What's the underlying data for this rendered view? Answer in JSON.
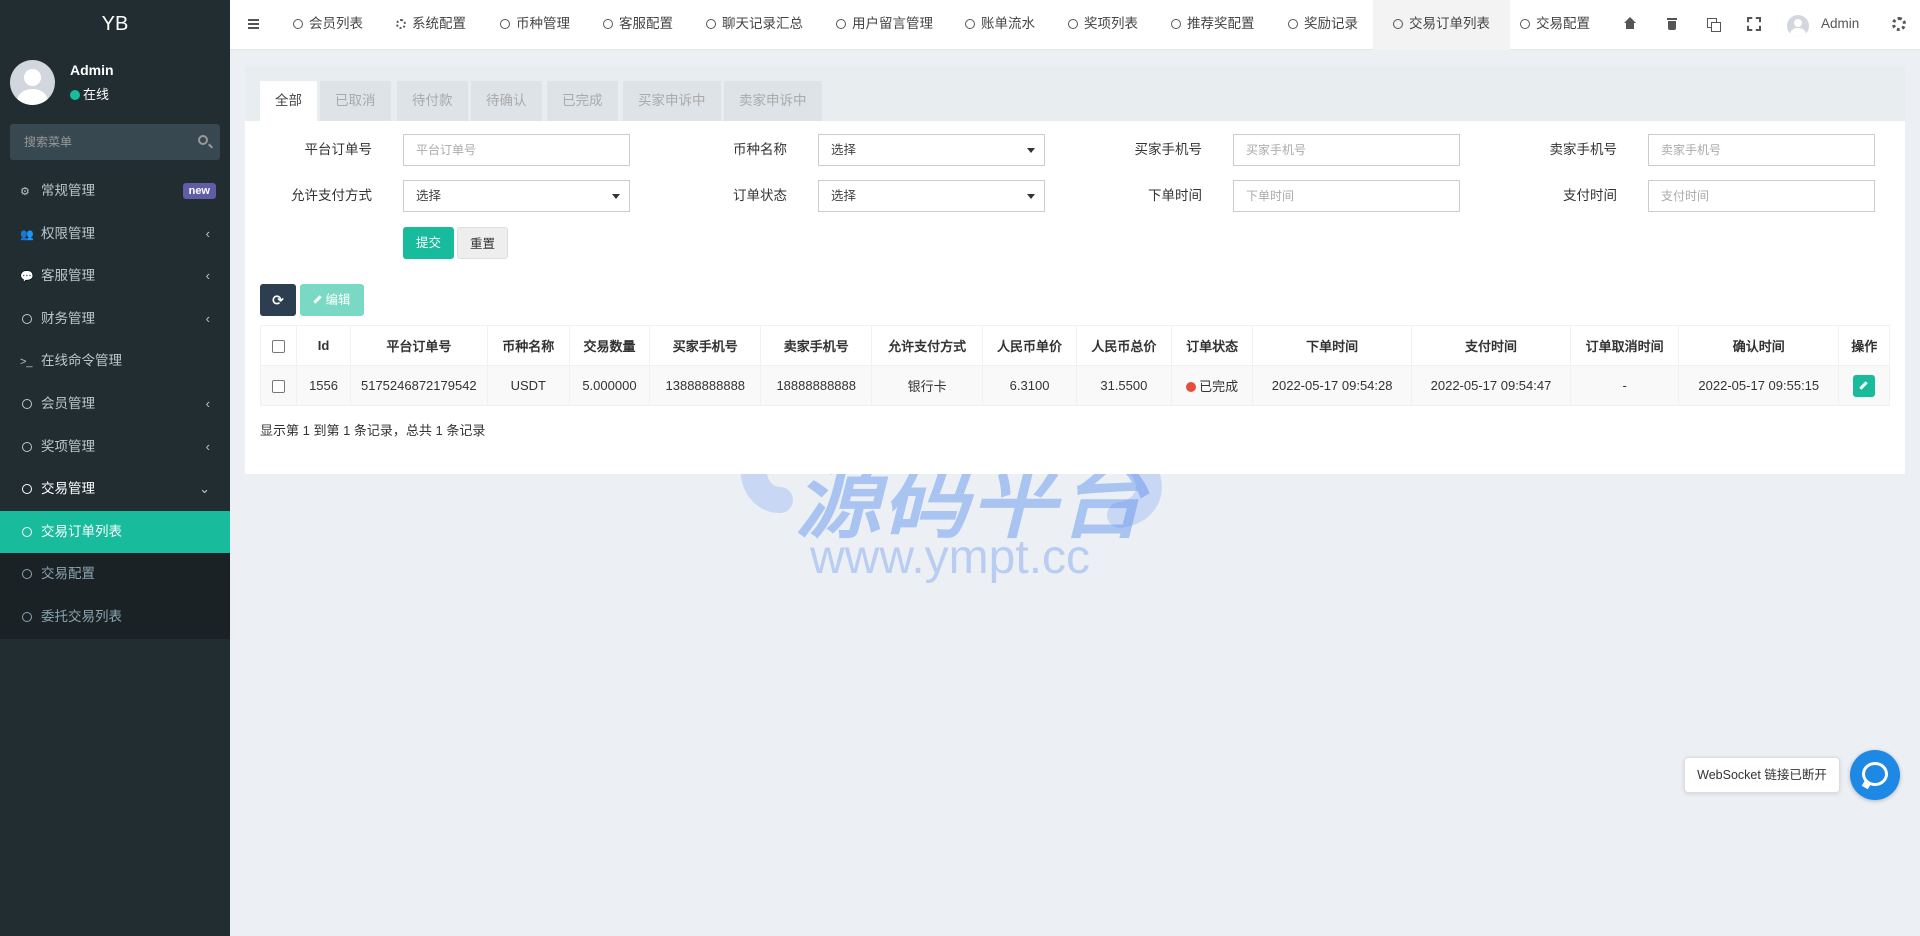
{
  "sidebar": {
    "logo": "YB",
    "user": {
      "name": "Admin",
      "status": "在线"
    },
    "search_placeholder": "搜索菜单",
    "menu": [
      {
        "label": "常规管理",
        "badge": "new"
      },
      {
        "label": "权限管理"
      },
      {
        "label": "客服管理"
      },
      {
        "label": "财务管理"
      },
      {
        "label": "在线命令管理"
      },
      {
        "label": "会员管理"
      },
      {
        "label": "奖项管理"
      },
      {
        "label": "交易管理"
      }
    ],
    "submenu": [
      {
        "label": "交易订单列表"
      },
      {
        "label": "交易配置"
      },
      {
        "label": "委托交易列表"
      }
    ]
  },
  "topnav": {
    "items": [
      {
        "label": "会员列表"
      },
      {
        "label": "系统配置"
      },
      {
        "label": "币种管理"
      },
      {
        "label": "客服配置"
      },
      {
        "label": "聊天记录汇总"
      },
      {
        "label": "用户留言管理"
      },
      {
        "label": "账单流水"
      },
      {
        "label": "奖项列表"
      },
      {
        "label": "推荐奖配置"
      },
      {
        "label": "奖励记录"
      },
      {
        "label": "交易订单列表"
      },
      {
        "label": "交易配置"
      }
    ],
    "admin_name": "Admin"
  },
  "status_tabs": [
    "全部",
    "已取消",
    "待付款",
    "待确认",
    "已完成",
    "买家申诉中",
    "卖家申诉中"
  ],
  "filters": {
    "platform_order_no": {
      "label": "平台订单号",
      "placeholder": "平台订单号"
    },
    "coin_name": {
      "label": "币种名称",
      "value": "选择"
    },
    "buyer_phone": {
      "label": "买家手机号",
      "placeholder": "买家手机号"
    },
    "seller_phone": {
      "label": "卖家手机号",
      "placeholder": "卖家手机号"
    },
    "payment_method": {
      "label": "允许支付方式",
      "value": "选择"
    },
    "order_status": {
      "label": "订单状态",
      "value": "选择"
    },
    "order_time": {
      "label": "下单时间",
      "placeholder": "下单时间"
    },
    "pay_time": {
      "label": "支付时间",
      "placeholder": "支付时间"
    },
    "submit_label": "提交",
    "reset_label": "重置"
  },
  "toolbar": {
    "edit_label": "编辑"
  },
  "table": {
    "columns": [
      "Id",
      "平台订单号",
      "币种名称",
      "交易数量",
      "买家手机号",
      "卖家手机号",
      "允许支付方式",
      "人民币单价",
      "人民币总价",
      "订单状态",
      "下单时间",
      "支付时间",
      "订单取消时间",
      "确认时间",
      "操作"
    ],
    "rows": [
      {
        "id": "1556",
        "order_no": "5175246872179542",
        "coin": "USDT",
        "amount": "5.000000",
        "buyer_phone": "13888888888",
        "seller_phone": "18888888888",
        "pay_method": "银行卡",
        "unit_price": "6.3100",
        "total_price": "31.5500",
        "status": "已完成",
        "order_time": "2022-05-17 09:54:28",
        "pay_time": "2022-05-17 09:54:47",
        "cancel_time": "-",
        "confirm_time": "2022-05-17 09:55:15"
      }
    ],
    "summary": "显示第 1 到第 1 条记录，总共 1 条记录"
  },
  "watermark": {
    "text": "源码平台",
    "url": "www.ympt.cc"
  },
  "websocket_tip": "WebSocket 链接已断开",
  "colors": {
    "primary": "#18bc9c",
    "sidebar": "#222d32",
    "badge": "#605ca8",
    "danger": "#e74c3c",
    "dark_button": "#2c3e50"
  }
}
